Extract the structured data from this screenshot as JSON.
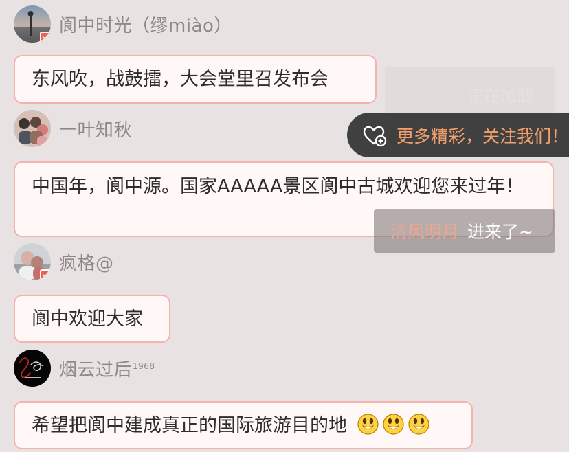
{
  "messages": [
    {
      "username": "阆中时光（缪miào）",
      "text": "东风吹，战鼓擂，大会堂里召发布会",
      "avatar_icon": "sunset-lake-avatar",
      "has_badge": true
    },
    {
      "username": "一叶知秋",
      "text": "中国年，阆中源。国家AAAAA景区阆中古城欢迎您来过年！",
      "avatar_icon": "group-photo-avatar",
      "has_badge": false
    },
    {
      "username": "疯格@",
      "text": "阆中欢迎大家",
      "avatar_icon": "person-photo-avatar",
      "has_badge": true
    },
    {
      "username": "烟云过后",
      "username_suffix": "1968",
      "text": "希望把阆中建成真正的国际旅游目的地",
      "avatar_icon": "black-logo-avatar",
      "has_badge": false,
      "emojis": [
        "smile-emoji",
        "smile-emoji",
        "smile-emoji"
      ]
    }
  ],
  "overlay": {
    "follow_tip_text": "更多精彩，关注我们！",
    "follow_icon": "heart-plus-icon",
    "faded_panel_text": "正在加载",
    "enter_notice": {
      "name": "清风明月",
      "text": "进来了~"
    }
  }
}
